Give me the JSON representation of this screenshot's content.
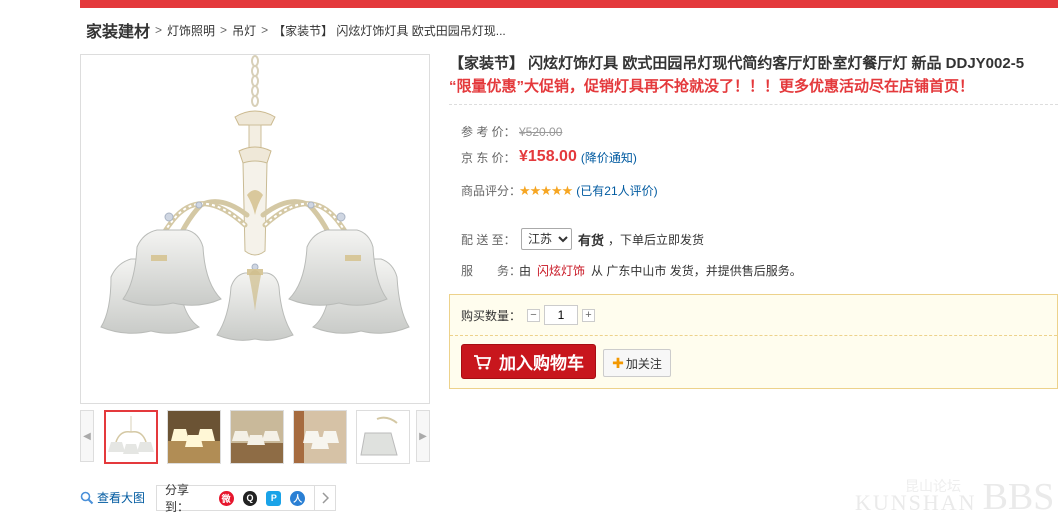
{
  "breadcrumb": {
    "root": "家装建材",
    "sep": ">",
    "items": [
      "灯饰照明",
      "吊灯",
      "【家装节】 闪炫灯饰灯具 欧式田园吊灯现..."
    ]
  },
  "product": {
    "title": "【家装节】 闪炫灯饰灯具 欧式田园吊灯现代简约客厅灯卧室灯餐厅灯 新品 DDJY002-5",
    "promo": "“限量优惠”大促销，促销灯具再不抢就没了！！！更多优惠活动尽在店铺首页！"
  },
  "pricing": {
    "ref_label": "参 考 价：",
    "ref_price": "¥520.00",
    "jd_label": "京 东 价：",
    "jd_price": "¥158.00",
    "notify": "(降价通知)",
    "rating_label": "商品评分：",
    "stars": "★★★★★",
    "rating_count": "(已有21人评价)"
  },
  "delivery": {
    "label": "配 送 至：",
    "region": "江苏",
    "stock": "有货",
    "note": "，下单后立即发货"
  },
  "service": {
    "label": "服　　务：",
    "prefix": "由",
    "seller": "闪炫灯饰",
    "suffix": "从 广东中山市 发货，并提供售后服务。"
  },
  "buy": {
    "qty_label": "购买数量：",
    "minus": "−",
    "qty": "1",
    "plus": "+",
    "cart_label": "加入购物车",
    "follow_label": "加关注"
  },
  "gallery": {
    "view_large": "查看大图",
    "share_label": "分享到："
  },
  "watermark": {
    "cn": "昆山论坛",
    "en": "KUNSHAN",
    "bbs": "BBS"
  },
  "colors": {
    "accent": "#e4393c",
    "link": "#005aa0",
    "cart": "#c8161d"
  }
}
